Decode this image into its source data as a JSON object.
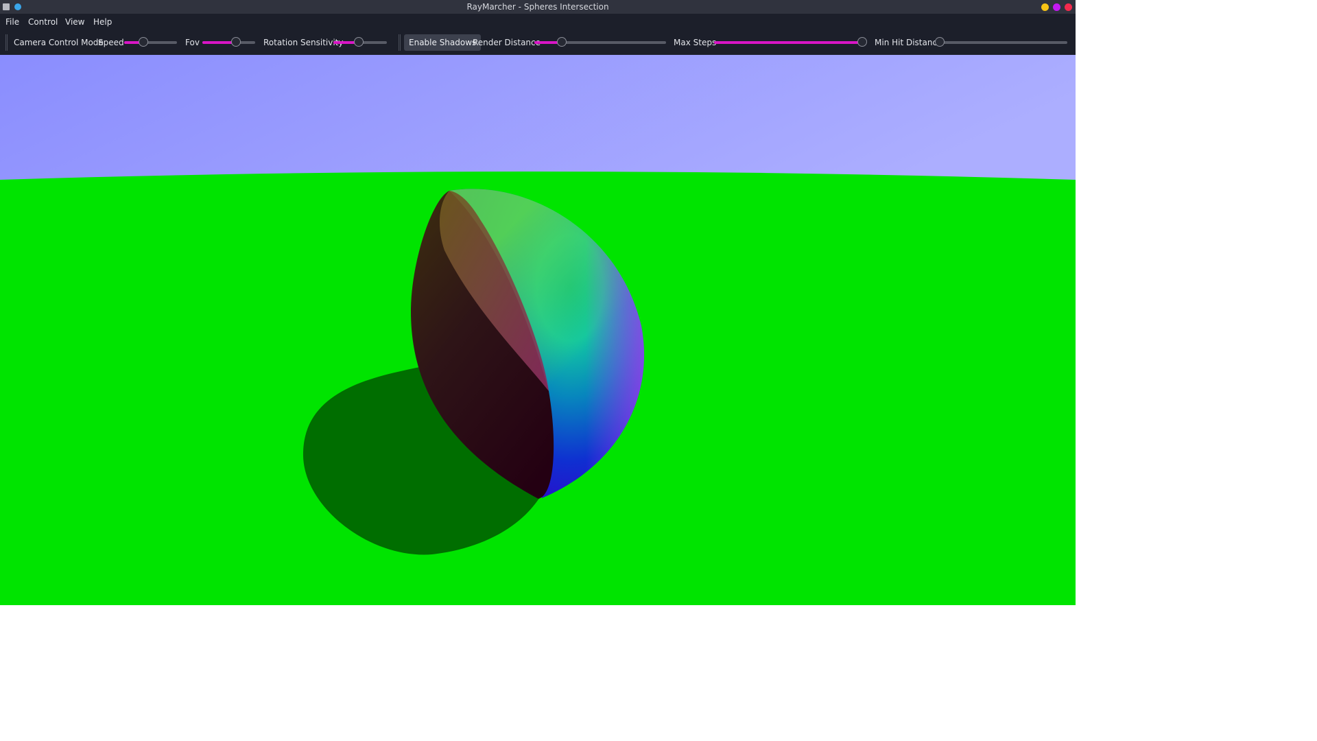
{
  "window": {
    "title": "RayMarcher - Spheres Intersection"
  },
  "menu": [
    "File",
    "Control",
    "View",
    "Help"
  ],
  "toolbar": {
    "camera_mode_label": "Camera Control Mode",
    "speed": {
      "label": "Speed",
      "value": 0.37
    },
    "fov": {
      "label": "Fov",
      "value": 0.64
    },
    "rotation_sensitivity": {
      "label": "Rotation Sensitivity",
      "value": 0.48
    },
    "enable_shadows_label": "Enable Shadows",
    "render_distance": {
      "label": "Render Distance",
      "value": 0.21
    },
    "max_steps": {
      "label": "Max Steps",
      "value": 1.0
    },
    "min_hit_distance": {
      "label": "Min Hit Distance",
      "value": 0.0
    }
  },
  "colors": {
    "accent": "#d915c6",
    "sky_left": "#8a8dfe",
    "sky_right": "#acaeff",
    "ground": "#00e400",
    "shadow": "#006e00"
  },
  "icons": {
    "app": "app-icon",
    "pin": "pin-icon",
    "minimize": "minimize-icon",
    "maximize": "maximize-icon",
    "close": "close-icon"
  }
}
